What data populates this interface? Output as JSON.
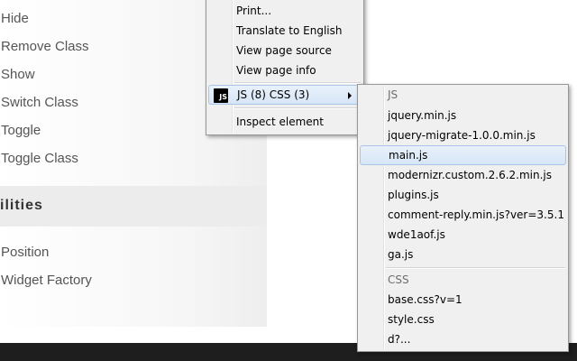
{
  "sidebar": {
    "links_top": [
      "Hide",
      "Remove Class",
      "Show",
      "Switch Class",
      "Toggle",
      "Toggle Class"
    ],
    "section_title": "ilities",
    "links_bottom": [
      "Position",
      "Widget Factory"
    ]
  },
  "context_menu": {
    "items": {
      "print": "Print...",
      "translate": "Translate to English",
      "view_source": "View page source",
      "page_info": "View page info",
      "scripts": "JS (8) CSS (3)",
      "inspect": "Inspect element"
    },
    "icons": {
      "scripts_icon": "js-icon",
      "scripts_icon_text": "JS",
      "submenu_arrow": "chevron-right-icon"
    }
  },
  "submenu": {
    "js_header": "JS",
    "js_files": [
      "jquery.min.js",
      "jquery-migrate-1.0.0.min.js",
      "main.js",
      "modernizr.custom.2.6.2.min.js",
      "plugins.js",
      "comment-reply.min.js?ver=3.5.1",
      "wde1aof.js",
      "ga.js"
    ],
    "css_header": "CSS",
    "css_files": [
      "base.css?v=1",
      "style.css",
      "d?..."
    ],
    "highlighted_item": "main.js"
  },
  "colors": {
    "menu_background": "#f0f0f0",
    "menu_highlight": "#d7e6f6",
    "footer": "#1e1e1e",
    "link_text": "#555555"
  }
}
